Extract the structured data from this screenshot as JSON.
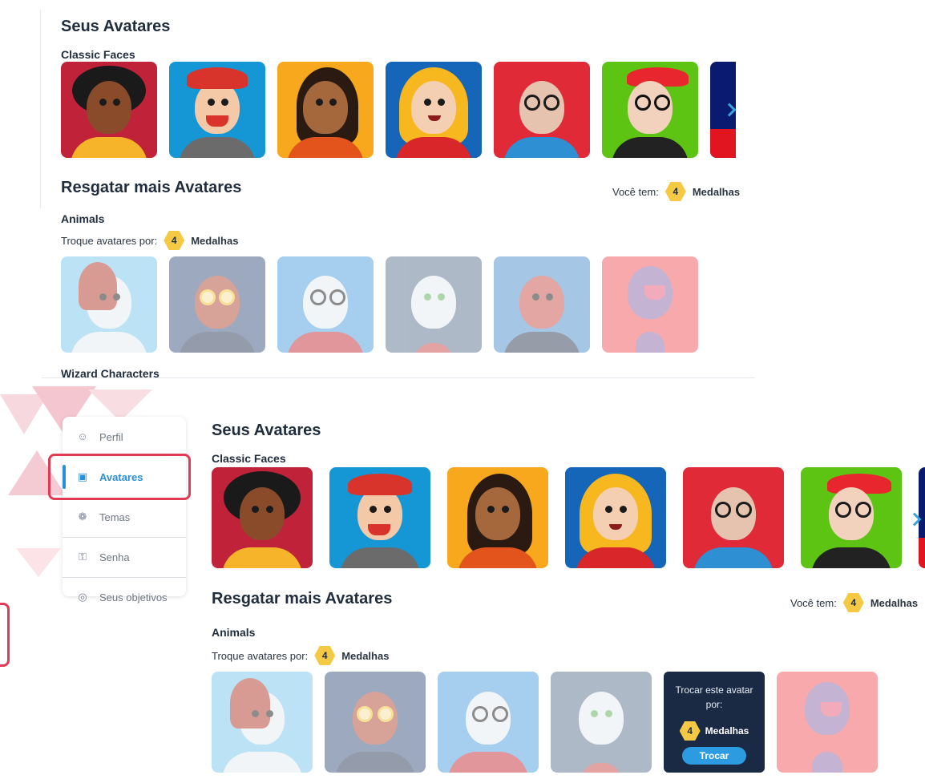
{
  "top": {
    "section_title": "Seus Avatares",
    "classic_title": "Classic Faces",
    "redeem_title": "Resgatar mais Avatares",
    "you_have_label": "Você tem:",
    "you_have_count": "4",
    "you_have_unit": "Medalhas",
    "animals_title": "Animals",
    "exchange_label": "Troque avatares por:",
    "exchange_count": "4",
    "exchange_unit": "Medalhas",
    "wizard_title": "Wizard Characters"
  },
  "bottom": {
    "sidebar": {
      "items": [
        {
          "label": "Perfil",
          "icon": "user-icon"
        },
        {
          "label": "Avatares",
          "icon": "image-icon"
        },
        {
          "label": "Temas",
          "icon": "palette-icon"
        },
        {
          "label": "Senha",
          "icon": "key-icon"
        },
        {
          "label": "Seus objetivos",
          "icon": "target-icon"
        }
      ],
      "active_index": 1
    },
    "section_title": "Seus Avatares",
    "classic_title": "Classic Faces",
    "redeem_title": "Resgatar mais Avatares",
    "you_have_label": "Você tem:",
    "you_have_count": "4",
    "you_have_unit": "Medalhas",
    "animals_title": "Animals",
    "exchange_label": "Troque avatares por:",
    "exchange_count": "4",
    "exchange_unit": "Medalhas",
    "tooltip": {
      "text": "Trocar este avatar por:",
      "count": "4",
      "unit": "Medalhas",
      "button": "Trocar"
    }
  },
  "colors": {
    "accent": "#2a8fd6",
    "highlight": "#e23a55",
    "medal": "#f6c945",
    "tooltip_bg": "#1a2a44"
  }
}
